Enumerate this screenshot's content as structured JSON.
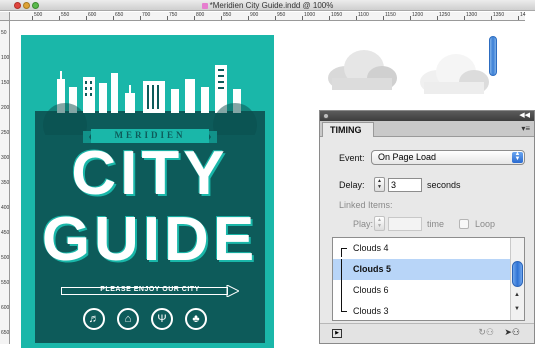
{
  "window": {
    "title": "*Meridien City Guide.indd @ 100%"
  },
  "ruler": {
    "h_labels": [
      "500",
      "550",
      "600",
      "650",
      "700",
      "750",
      "800",
      "850",
      "900",
      "950",
      "1000",
      "1050",
      "1100",
      "1150",
      "1200",
      "1250",
      "1300",
      "1350",
      "14"
    ],
    "v_labels": [
      "50",
      "100",
      "150",
      "200",
      "250",
      "300",
      "350",
      "400",
      "450",
      "500",
      "550",
      "600",
      "650"
    ]
  },
  "poster": {
    "banner": "MERIDIEN",
    "line1": "CITY",
    "line2": "GUIDE",
    "tagline": "PLEASE ENJOY OUR CITY",
    "icons": [
      "guitar-icon",
      "home-icon",
      "dining-icon",
      "tree-icon"
    ],
    "colors": {
      "teal": "#1ab7a9",
      "dark": "#0d5b5a",
      "white": "#ffffff"
    }
  },
  "panel": {
    "tab": "TIMING",
    "event_label": "Event:",
    "event_value": "On Page Load",
    "delay_label": "Delay:",
    "delay_value": "3",
    "delay_unit": "seconds",
    "linked_label": "Linked Items:",
    "play_label": "Play:",
    "play_unit": "time",
    "loop_label": "Loop",
    "items": [
      {
        "label": "Clouds 4",
        "selected": false
      },
      {
        "label": "Clouds 5",
        "selected": true
      },
      {
        "label": "Clouds 6",
        "selected": false
      },
      {
        "label": "Clouds 3",
        "selected": false
      }
    ]
  }
}
